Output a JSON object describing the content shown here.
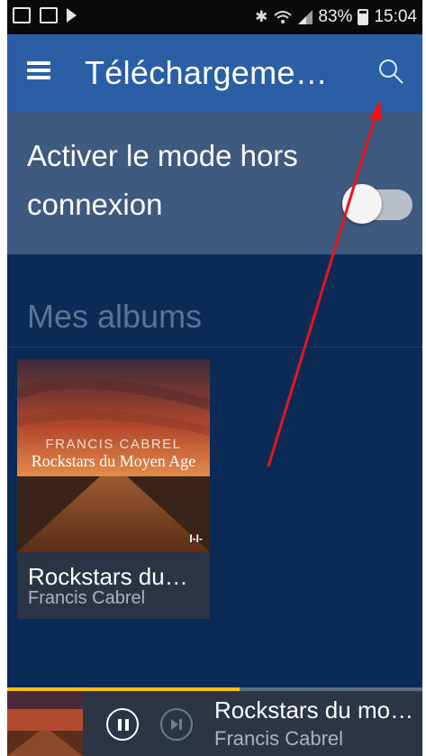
{
  "status_bar": {
    "battery_text": "83%",
    "time": "15:04",
    "icons": [
      "gallery-icon",
      "app-notification-icon",
      "play-icon",
      "bluetooth-icon",
      "wifi-icon",
      "signal-icon",
      "battery-icon"
    ]
  },
  "app_bar": {
    "title": "Téléchargeme…",
    "menu_icon": "menu-icon",
    "search_icon": "search-icon"
  },
  "offline_mode": {
    "label": "Activer le mode hors connexion",
    "enabled": false
  },
  "albums_section": {
    "heading": "Mes albums",
    "albums": [
      {
        "title": "Rockstars du…",
        "artist": "Francis Cabrel",
        "cover_artist_text": "FRANCIS CABREL",
        "cover_title_text": "Rockstars du Moyen Age"
      }
    ]
  },
  "mini_player": {
    "title": "Rockstars du mo…",
    "artist": "Francis Cabrel",
    "progress": 0.56,
    "pause_icon": "pause-icon",
    "next_icon": "skip-next-icon"
  },
  "colors": {
    "app_bar": "#2a5fa5",
    "background": "#0b2a56",
    "offline_panel": "#3e5a7e",
    "progress_fill": "#ffc107",
    "annotation_arrow": "#e8161b"
  }
}
